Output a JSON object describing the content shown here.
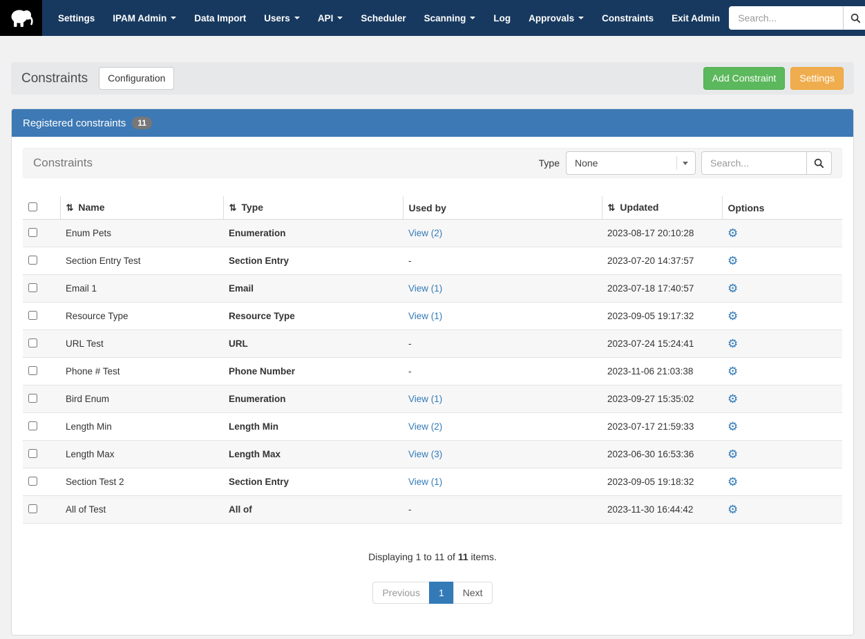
{
  "colors": {
    "navbar_bg": "#17395f",
    "panel_header_bg": "#3d79b4",
    "link": "#337ab7",
    "success": "#5cb85c",
    "warning": "#f0ad4e"
  },
  "navbar": {
    "logo_icon": "mammoth-icon",
    "items": [
      {
        "label": "Settings",
        "dropdown": false
      },
      {
        "label": "IPAM Admin",
        "dropdown": true
      },
      {
        "label": "Data Import",
        "dropdown": false
      },
      {
        "label": "Users",
        "dropdown": true
      },
      {
        "label": "API",
        "dropdown": true
      },
      {
        "label": "Scheduler",
        "dropdown": false
      },
      {
        "label": "Scanning",
        "dropdown": true
      },
      {
        "label": "Log",
        "dropdown": false
      },
      {
        "label": "Approvals",
        "dropdown": true
      },
      {
        "label": "Constraints",
        "dropdown": false
      },
      {
        "label": "Exit Admin",
        "dropdown": false
      }
    ],
    "search": {
      "placeholder": "Search...",
      "value": "",
      "button_icon": "search-icon"
    },
    "user_icon": "user-icon"
  },
  "page_header": {
    "title": "Constraints",
    "configuration_button": "Configuration",
    "add_constraint_button": "Add Constraint",
    "settings_button": "Settings"
  },
  "panel": {
    "title": "Registered constraints",
    "count_badge": "11",
    "toolbar": {
      "title": "Constraints",
      "type_label": "Type",
      "type_selected": "None",
      "search_placeholder": "Search...",
      "search_value": ""
    },
    "table": {
      "headers": [
        {
          "label": "Name",
          "sortable": true
        },
        {
          "label": "Type",
          "sortable": true
        },
        {
          "label": "Used by",
          "sortable": false
        },
        {
          "label": "Updated",
          "sortable": true
        },
        {
          "label": "Options",
          "sortable": false
        }
      ],
      "rows": [
        {
          "name": "Enum Pets",
          "type": "Enumeration",
          "used_by": "View (2)",
          "used_by_is_link": true,
          "updated": "2023-08-17 20:10:28",
          "options_icon": "gear-icon"
        },
        {
          "name": "Section Entry Test",
          "type": "Section Entry",
          "used_by": "-",
          "used_by_is_link": false,
          "updated": "2023-07-20 14:37:57",
          "options_icon": "gear-icon"
        },
        {
          "name": "Email 1",
          "type": "Email",
          "used_by": "View (1)",
          "used_by_is_link": true,
          "updated": "2023-07-18 17:40:57",
          "options_icon": "gear-icon"
        },
        {
          "name": "Resource Type",
          "type": "Resource Type",
          "used_by": "View (1)",
          "used_by_is_link": true,
          "updated": "2023-09-05 19:17:32",
          "options_icon": "gear-icon"
        },
        {
          "name": "URL Test",
          "type": "URL",
          "used_by": "-",
          "used_by_is_link": false,
          "updated": "2023-07-24 15:24:41",
          "options_icon": "gear-icon"
        },
        {
          "name": "Phone # Test",
          "type": "Phone Number",
          "used_by": "-",
          "used_by_is_link": false,
          "updated": "2023-11-06 21:03:38",
          "options_icon": "gear-icon"
        },
        {
          "name": "Bird Enum",
          "type": "Enumeration",
          "used_by": "View (1)",
          "used_by_is_link": true,
          "updated": "2023-09-27 15:35:02",
          "options_icon": "gear-icon"
        },
        {
          "name": "Length Min",
          "type": "Length Min",
          "used_by": "View (2)",
          "used_by_is_link": true,
          "updated": "2023-07-17 21:59:33",
          "options_icon": "gear-icon"
        },
        {
          "name": "Length Max",
          "type": "Length Max",
          "used_by": "View (3)",
          "used_by_is_link": true,
          "updated": "2023-06-30 16:53:36",
          "options_icon": "gear-icon"
        },
        {
          "name": "Section Test 2",
          "type": "Section Entry",
          "used_by": "View (1)",
          "used_by_is_link": true,
          "updated": "2023-09-05 19:18:32",
          "options_icon": "gear-icon"
        },
        {
          "name": "All of Test",
          "type": "All of",
          "used_by": "-",
          "used_by_is_link": false,
          "updated": "2023-11-30 16:44:42",
          "options_icon": "gear-icon"
        }
      ]
    },
    "summary": {
      "text_before": "Displaying 1 to 11 of ",
      "count": "11",
      "text_after": " items."
    },
    "pagination": {
      "previous": "Previous",
      "current_page": "1",
      "next": "Next"
    }
  }
}
